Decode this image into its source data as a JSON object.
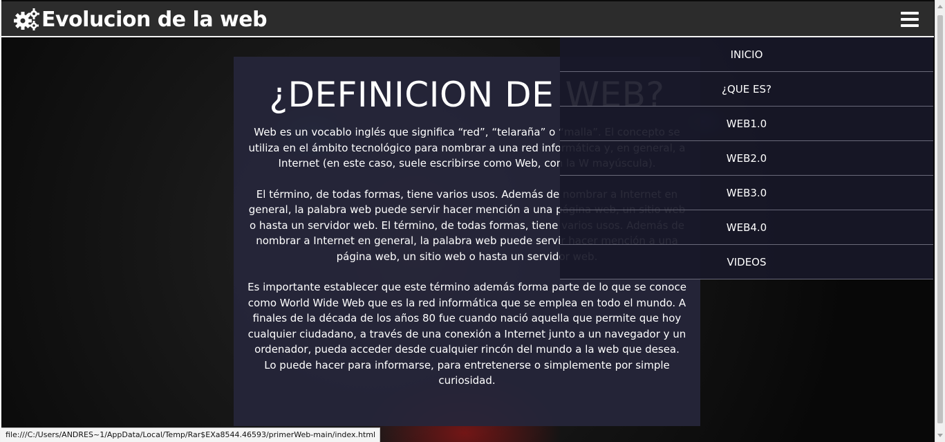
{
  "header": {
    "title": "Evolucion de la web",
    "logo_icon": "gears-icon",
    "menu_icon": "hamburger-icon"
  },
  "menu": {
    "items": [
      {
        "label": "INICIO"
      },
      {
        "label": "¿QUE ES?"
      },
      {
        "label": "WEB1.0"
      },
      {
        "label": "WEB2.0"
      },
      {
        "label": "WEB3.0"
      },
      {
        "label": "WEB4.0"
      },
      {
        "label": "VIDEOS"
      }
    ]
  },
  "content": {
    "heading": "¿DEFINICION DE WEB?",
    "paragraphs": [
      "Web es un vocablo inglés que significa “red”, “telaraña” o “malla”. El concepto se utiliza en el ámbito tecnológico para nombrar a una red informática y, en general, a Internet (en este caso, suele escribirse como Web, con la W mayúscula).",
      "El término, de todas formas, tiene varios usos. Además de nombrar a Internet en general, la palabra web puede servir hacer mención a una página web, un sitio web o hasta un servidor web. El término, de todas formas, tiene varios usos. Además de nombrar a Internet en general, la palabra web puede servir hacer mención a una página web, un sitio web o hasta un servidor web.",
      "Es importante establecer que este término además forma parte de lo que se conoce como World Wide Web que es la red informática que se emplea en todo el mundo. A finales de la década de los años 80 fue cuando nació aquella que permite que hoy cualquier ciudadano, a través de una conexión a Internet junto a un navegador y un ordenador, pueda acceder desde cualquier rincón del mundo a la web que desea. Lo puede hacer para informarse, para entretenerse o simplemente por simple curiosidad."
    ]
  },
  "status_bar": {
    "url": "file:///C:/Users/ANDRES~1/AppData/Local/Temp/Rar$EXa8544.46593/primerWeb-main/index.html"
  },
  "colors": {
    "header_bg": "#2c2c2c",
    "panel_bg": "#26263a",
    "menu_bg": "#181828",
    "text": "#ffffff"
  }
}
